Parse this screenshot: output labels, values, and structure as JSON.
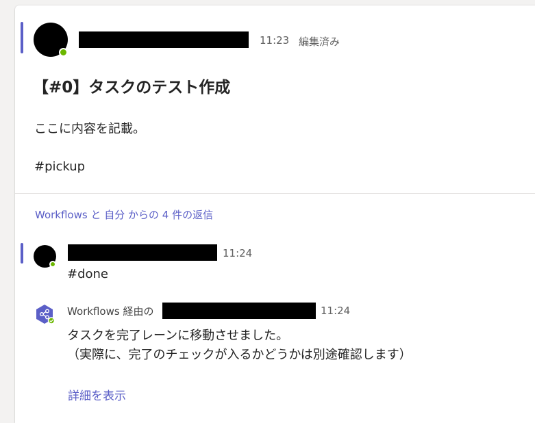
{
  "post": {
    "time": "11:23",
    "edited_label": "編集済み",
    "title": "【#0】タスクのテスト作成",
    "body_lines": [
      "ここに内容を記載。",
      "#pickup"
    ]
  },
  "replies_link": "Workflows と 自分 からの 4 件の返信",
  "reply1": {
    "time": "11:24",
    "text": "#done"
  },
  "reply2": {
    "via_label": "Workflows 経由の",
    "time": "11:24",
    "line1": "タスクを完了レーンに移動させました。",
    "line2": "（実際に、完了のチェックが入るかどうかは別途確認します）",
    "show_details": "詳細を表示",
    "icon": "workflows-icon"
  },
  "colors": {
    "accent": "#5b5fc7",
    "presence": "#6bb700",
    "redaction": "#000000"
  }
}
